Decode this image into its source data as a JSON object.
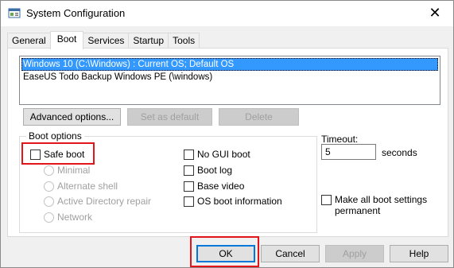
{
  "window": {
    "title": "System Configuration",
    "close_glyph": "✕"
  },
  "tabs": [
    {
      "label": "General"
    },
    {
      "label": "Boot"
    },
    {
      "label": "Services"
    },
    {
      "label": "Startup"
    },
    {
      "label": "Tools"
    }
  ],
  "os_list": [
    "Windows 10 (C:\\Windows) : Current OS; Default OS",
    "EaseUS Todo Backup Windows PE (\\windows)"
  ],
  "boot_buttons": {
    "advanced": "Advanced options...",
    "set_default": "Set as default",
    "delete": "Delete"
  },
  "boot_options": {
    "label": "Boot options",
    "safe_boot": "Safe boot",
    "minimal": "Minimal",
    "alternate_shell": "Alternate shell",
    "ad_repair": "Active Directory repair",
    "network": "Network",
    "no_gui_boot": "No GUI boot",
    "boot_log": "Boot log",
    "base_video": "Base video",
    "os_boot_info": "OS boot information"
  },
  "timeout": {
    "label": "Timeout:",
    "value": "5",
    "unit": "seconds"
  },
  "make_permanent": {
    "line1": "Make all boot settings",
    "line2": "permanent"
  },
  "footer_buttons": {
    "ok": "OK",
    "cancel": "Cancel",
    "apply": "Apply",
    "help": "Help"
  },
  "colors": {
    "highlight": "#e3151a",
    "selection": "#3399ff"
  }
}
